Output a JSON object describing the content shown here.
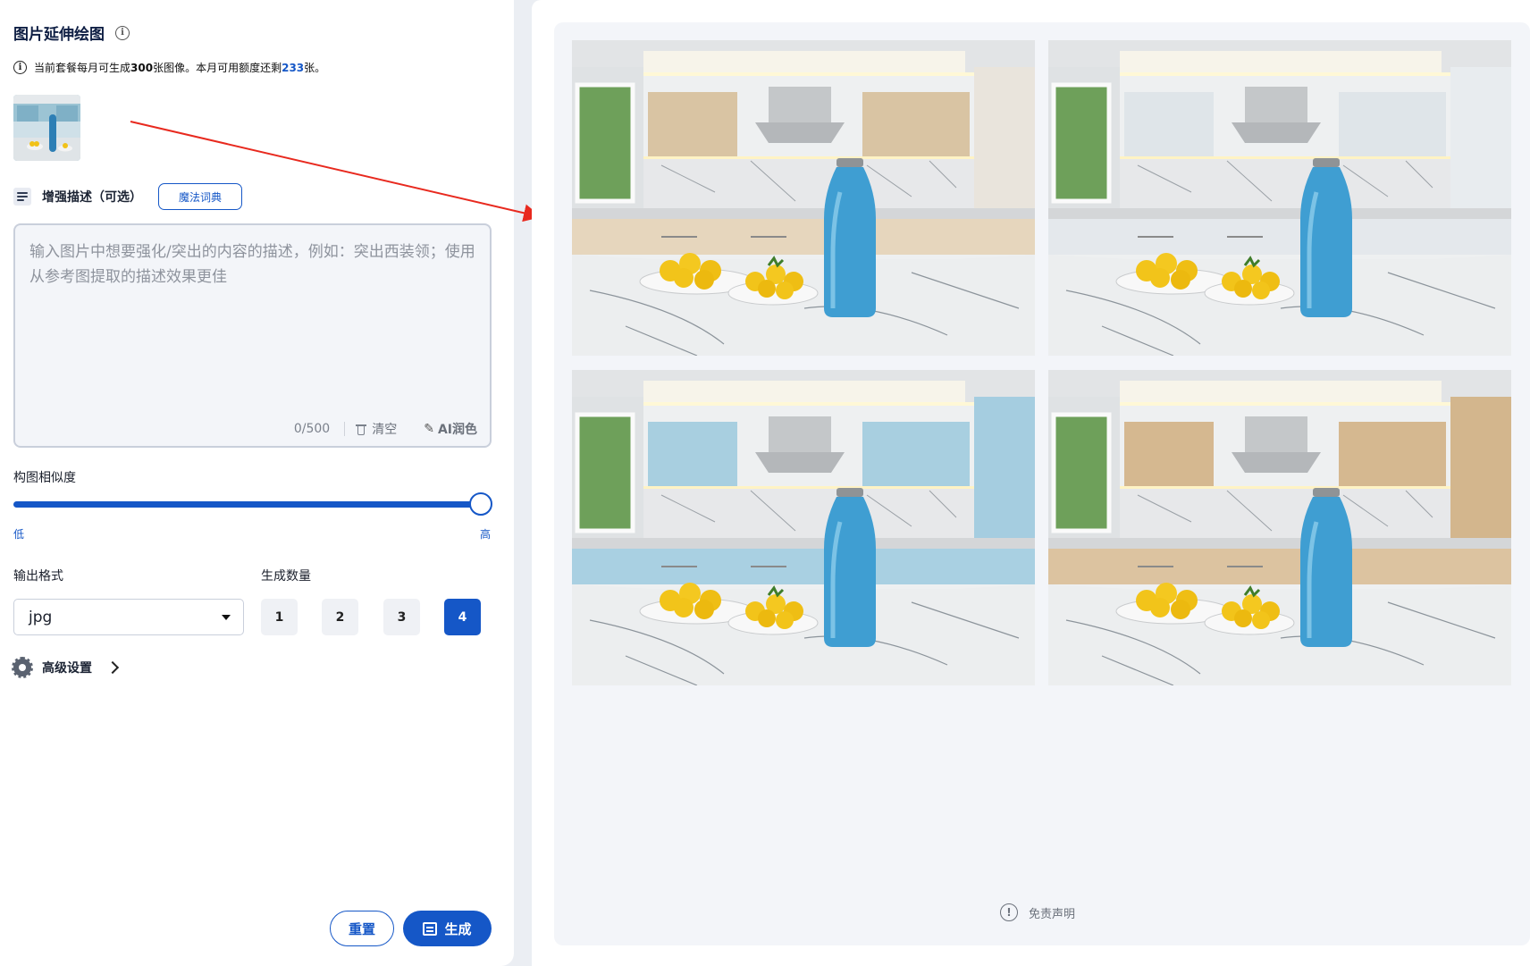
{
  "header": {
    "title": "图片延伸绘图",
    "quota_prefix": "当前套餐每月可生成",
    "quota_total": "300",
    "quota_middle": "张图像。本月可用额度还剩",
    "quota_remaining": "233",
    "quota_suffix": "张。"
  },
  "enhance": {
    "label": "增强描述（可选）",
    "magic_button": "魔法词典",
    "placeholder": "输入图片中想要强化/突出的内容的描述，例如：突出西装领；使用从参考图提取的描述效果更佳",
    "value": "",
    "counter": "0/500",
    "clear_label": "清空",
    "ai_label": "AI润色"
  },
  "similarity": {
    "label": "构图相似度",
    "value": 1.0,
    "low_label": "低",
    "high_label": "高"
  },
  "output_format": {
    "label": "输出格式",
    "selected": "jpg"
  },
  "generate_count": {
    "label": "生成数量",
    "options": [
      "1",
      "2",
      "3",
      "4"
    ],
    "selected": "4"
  },
  "advanced": {
    "label": "高级设置"
  },
  "actions": {
    "reset_label": "重置",
    "generate_label": "生成"
  },
  "results": {
    "disclaimer_label": "免责声明",
    "variants": [
      {
        "cabinet_upper": "#d9c4a3",
        "cabinet_lower": "#e6d6bd",
        "side": "#e9e4dc"
      },
      {
        "cabinet_upper": "#dfe5e9",
        "cabinet_lower": "#e4e8ec",
        "side": "#e8ecef"
      },
      {
        "cabinet_upper": "#a8cfe0",
        "cabinet_lower": "#a9d0e2",
        "side": "#a5cde0"
      },
      {
        "cabinet_upper": "#d5b890",
        "cabinet_lower": "#dcc3a0",
        "side": "#d3b68d"
      }
    ]
  },
  "colors": {
    "accent": "#1557c7",
    "arrow": "#e8291e"
  }
}
